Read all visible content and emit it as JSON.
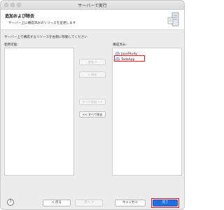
{
  "window": {
    "title": "サーバーで実行"
  },
  "header": {
    "title": "追加および除去",
    "description": "サーバー上に構成済みのリソースを変更します"
  },
  "instruction": "サーバー上で構成するリソースを右側に移動してください",
  "available": {
    "label": "使用可能:",
    "items": []
  },
  "configured": {
    "label": "構成済み:",
    "items": [
      {
        "label": "JavaStudy"
      },
      {
        "label": "TodoApp"
      }
    ]
  },
  "move_buttons": {
    "add": "追加 >",
    "remove": "< 除去",
    "add_all": "すべて追加 >>",
    "remove_all": "<< すべて除去"
  },
  "footer": {
    "help": "?",
    "back": "< 戻る",
    "next": "次へ >",
    "cancel": "キャンセル",
    "finish": "完了"
  },
  "colors": {
    "highlight": "#e6141c",
    "primary_button": "#1f6fe0"
  }
}
